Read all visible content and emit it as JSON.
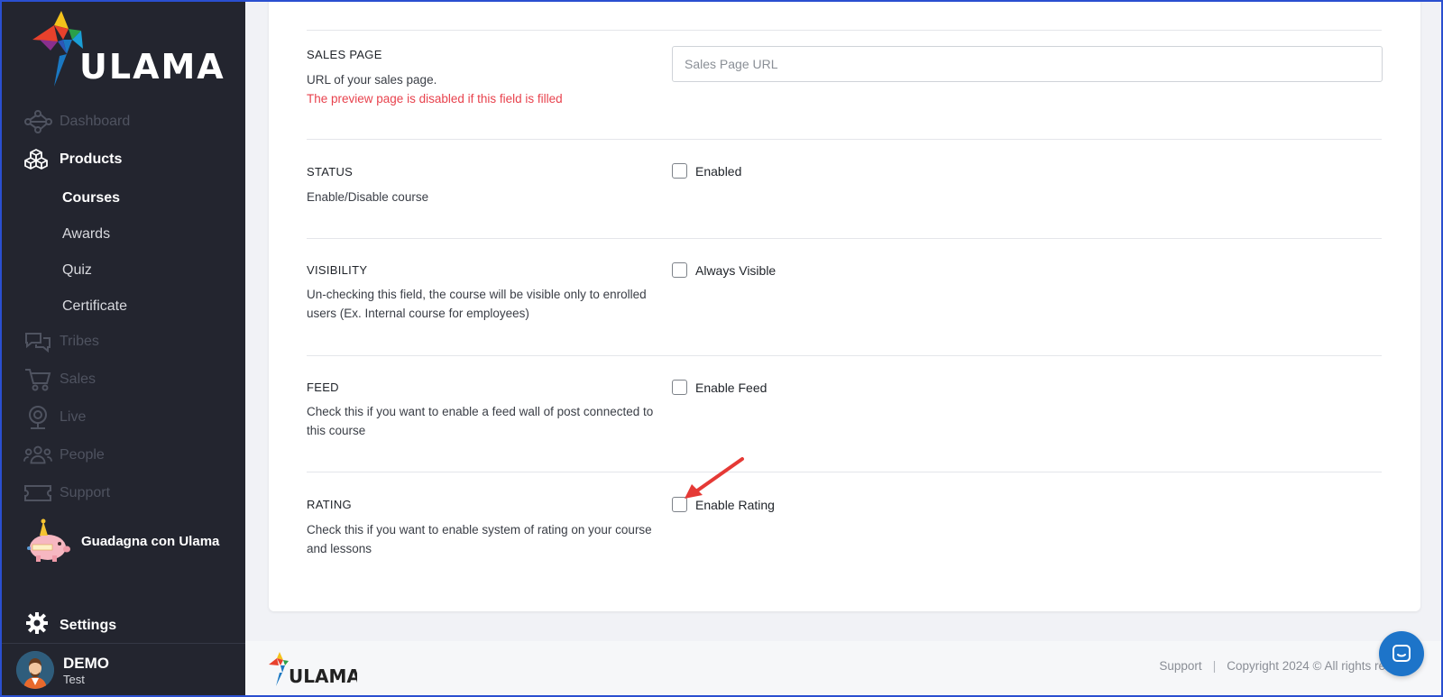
{
  "brand": {
    "name": "ULAMA"
  },
  "sidebar": {
    "items": [
      {
        "label": "Dashboard",
        "icon": "network-icon"
      },
      {
        "label": "Products",
        "icon": "cubes-icon"
      },
      {
        "label": "Tribes",
        "icon": "chat-bubbles-icon"
      },
      {
        "label": "Sales",
        "icon": "cart-icon"
      },
      {
        "label": "Live",
        "icon": "webcam-icon"
      },
      {
        "label": "People",
        "icon": "people-icon"
      },
      {
        "label": "Support",
        "icon": "ticket-icon"
      }
    ],
    "sub_items": [
      {
        "label": "Courses"
      },
      {
        "label": "Awards"
      },
      {
        "label": "Quiz"
      },
      {
        "label": "Certificate"
      }
    ],
    "promo": {
      "label": "Guadagna con Ulama",
      "icon": "piggy-bank-icon"
    },
    "settings": {
      "label": "Settings",
      "icon": "gear-icon"
    },
    "user": {
      "name": "DEMO",
      "subtitle": "Test"
    }
  },
  "form": {
    "sales_page": {
      "title": "SALES PAGE",
      "desc": "URL of your sales page.",
      "warning": "The preview page is disabled if this field is filled",
      "placeholder": "Sales Page URL",
      "value": ""
    },
    "status": {
      "title": "STATUS",
      "desc": "Enable/Disable course",
      "checkbox": "Enabled",
      "checked": false
    },
    "visibility": {
      "title": "VISIBILITY",
      "desc": "Un-checking this field, the course will be visible only to enrolled users (Ex. Internal course for employees)",
      "checkbox": "Always Visible",
      "checked": false
    },
    "feed": {
      "title": "FEED",
      "desc": "Check this if you want to enable a feed wall of post connected to this course",
      "checkbox": "Enable Feed",
      "checked": false
    },
    "rating": {
      "title": "RATING",
      "desc": "Check this if you want to enable system of rating on your course and lessons",
      "checkbox": "Enable Rating",
      "checked": false
    }
  },
  "footer": {
    "support": "Support",
    "separator": "|",
    "copyright": "Copyright 2024 © All rights re"
  },
  "colors": {
    "sidebar_bg": "#23252f",
    "accent_blue": "#1d74c9",
    "warning_red": "#e8424d",
    "arrow_red": "#e53935"
  }
}
